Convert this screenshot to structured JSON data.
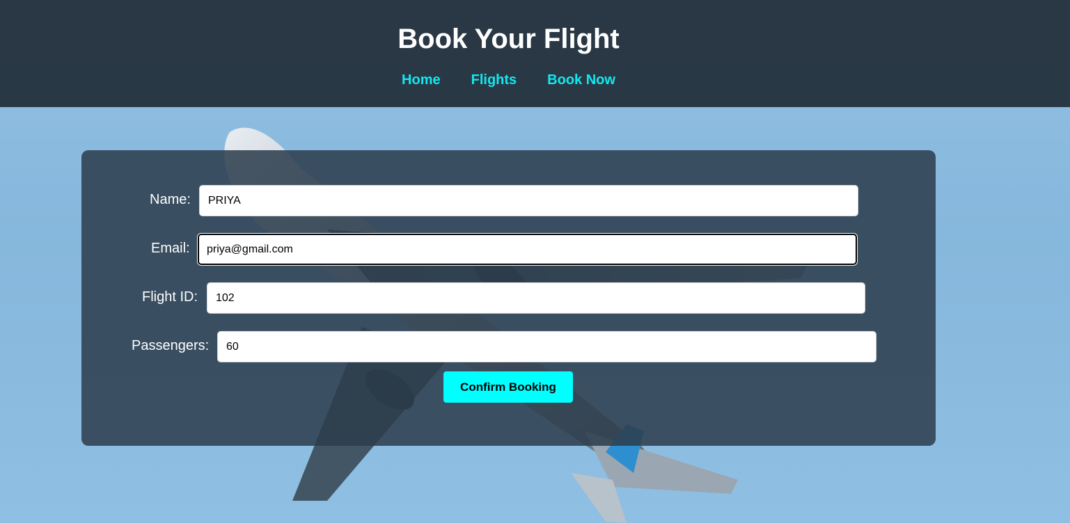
{
  "header": {
    "title": "Book Your Flight",
    "nav": [
      {
        "label": "Home"
      },
      {
        "label": "Flights"
      },
      {
        "label": "Book Now"
      }
    ]
  },
  "form": {
    "name": {
      "label": "Name:",
      "value": "PRIYA"
    },
    "email": {
      "label": "Email:",
      "value": "priya@gmail.com"
    },
    "flight_id": {
      "label": "Flight ID:",
      "value": "102"
    },
    "passengers": {
      "label": "Passengers:",
      "value": "60"
    },
    "submit_label": "Confirm Booking"
  },
  "colors": {
    "header_bg": "#263440",
    "nav_link": "#11e9f0",
    "button_bg": "#00ffff",
    "card_bg": "#2c3c4c"
  }
}
